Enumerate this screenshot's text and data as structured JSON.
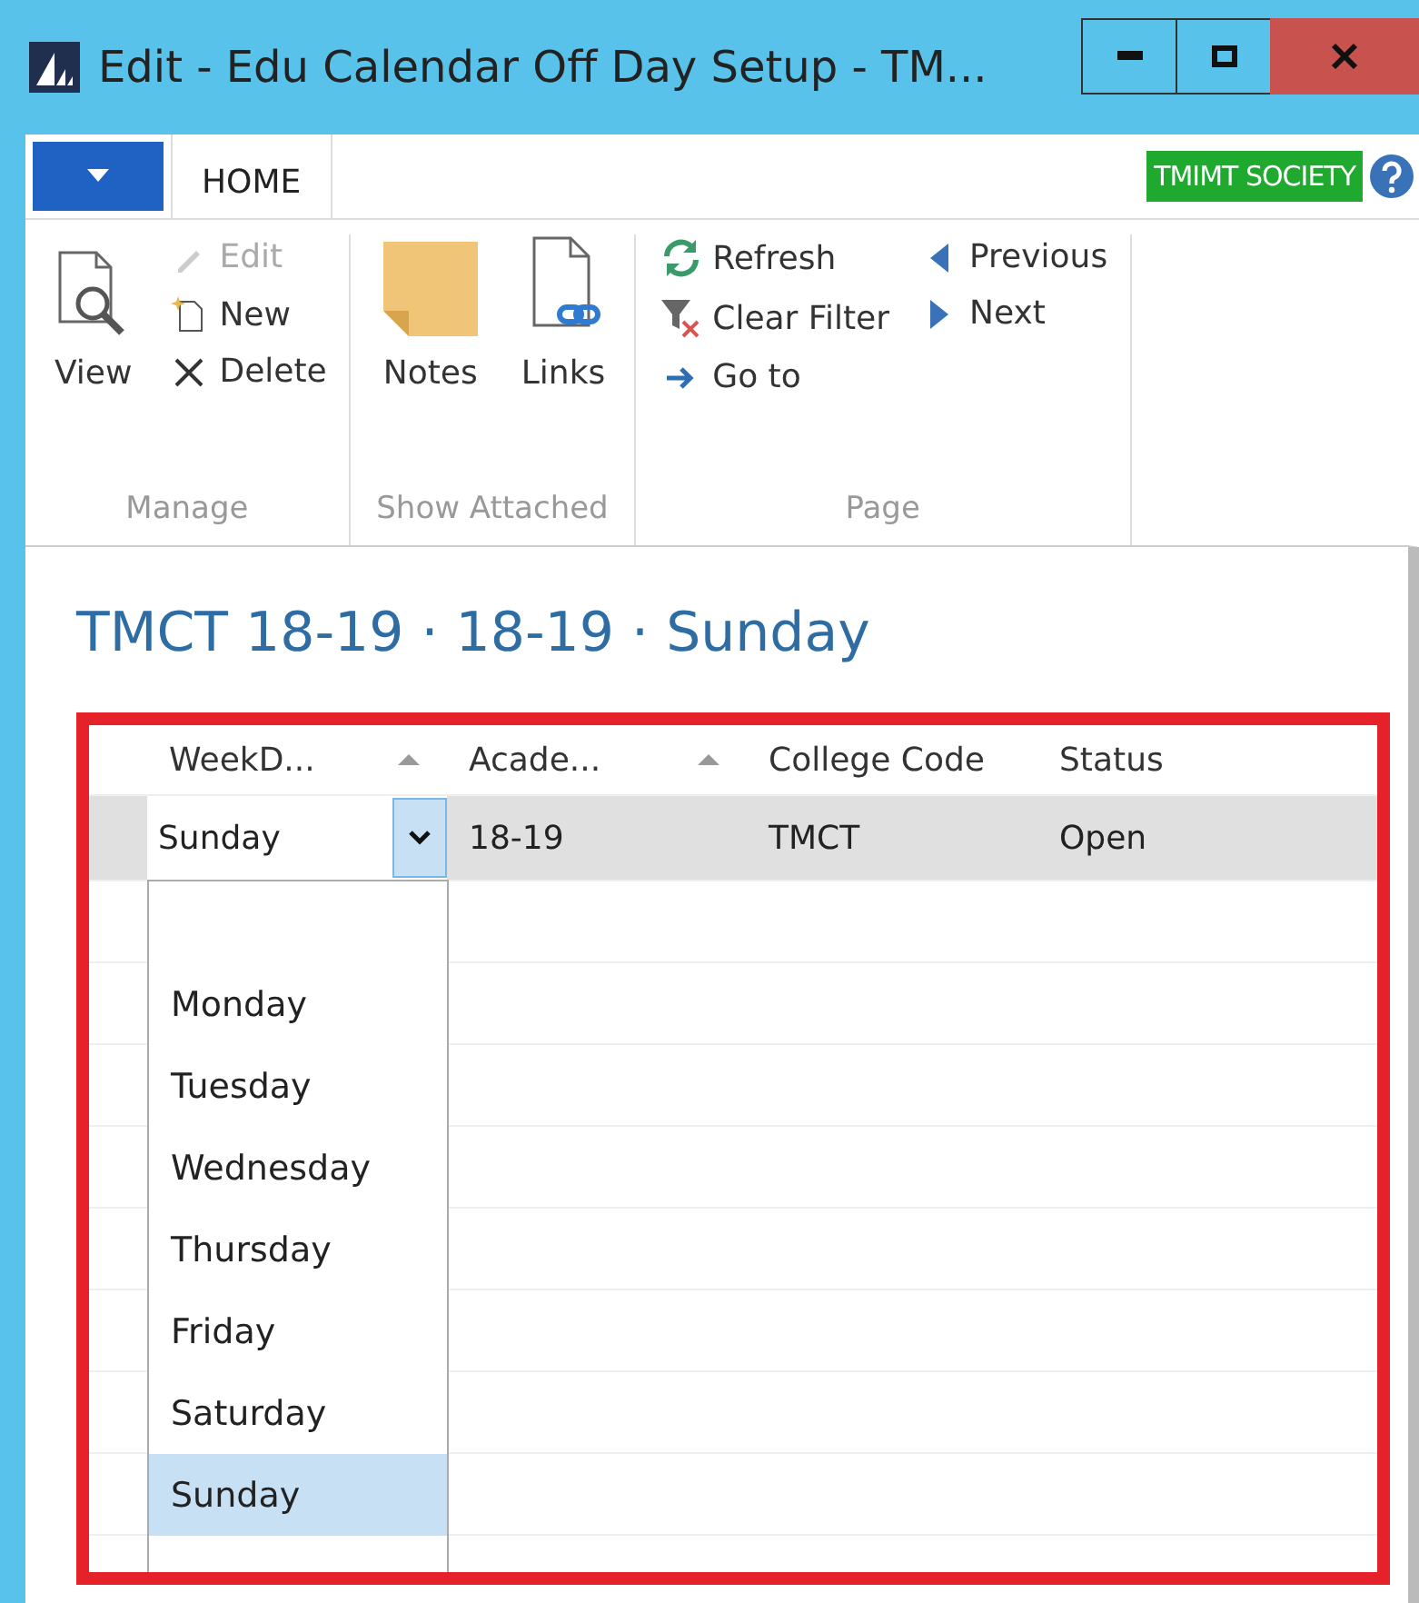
{
  "window": {
    "title": "Edit - Edu Calendar Off Day Setup - TM..."
  },
  "ribbon": {
    "tabs": [
      {
        "label": "HOME",
        "selected": true
      }
    ],
    "company": "TMIMT SOCIETY",
    "groups": [
      {
        "label": "Manage",
        "large": [
          {
            "label": "View"
          }
        ],
        "columns": [
          [
            {
              "label": "Edit",
              "disabled": true
            },
            {
              "label": "New",
              "disabled": false
            },
            {
              "label": "Delete",
              "disabled": false
            }
          ]
        ]
      },
      {
        "label": "Show Attached",
        "large": [
          {
            "label": "Notes"
          },
          {
            "label": "Links"
          }
        ]
      },
      {
        "label": "Page",
        "columns": [
          [
            {
              "label": "Refresh",
              "disabled": false
            },
            {
              "label": "Clear Filter",
              "disabled": false
            },
            {
              "label": "Go to",
              "disabled": false
            }
          ],
          [
            {
              "label": "Previous",
              "disabled": false
            },
            {
              "label": "Next",
              "disabled": false
            }
          ]
        ]
      }
    ]
  },
  "page_title": "TMCT 18-19 · 18-19 · Sunday",
  "table": {
    "columns": [
      {
        "label": "WeekD...",
        "sorted": true
      },
      {
        "label": "Acade...",
        "sorted": true
      },
      {
        "label": "College Code",
        "sorted": false
      },
      {
        "label": "Status",
        "sorted": false
      }
    ],
    "rows": [
      {
        "selected": true,
        "cells": [
          "Sunday",
          "18-19",
          "TMCT",
          "Open"
        ]
      }
    ]
  },
  "dropdown": {
    "expanded": true,
    "options": [
      {
        "label": "Monday",
        "selected": false
      },
      {
        "label": "Tuesday",
        "selected": false
      },
      {
        "label": "Wednesday",
        "selected": false
      },
      {
        "label": "Thursday",
        "selected": false
      },
      {
        "label": "Friday",
        "selected": false
      },
      {
        "label": "Saturday",
        "selected": false
      },
      {
        "label": "Sunday",
        "selected": true
      }
    ]
  }
}
